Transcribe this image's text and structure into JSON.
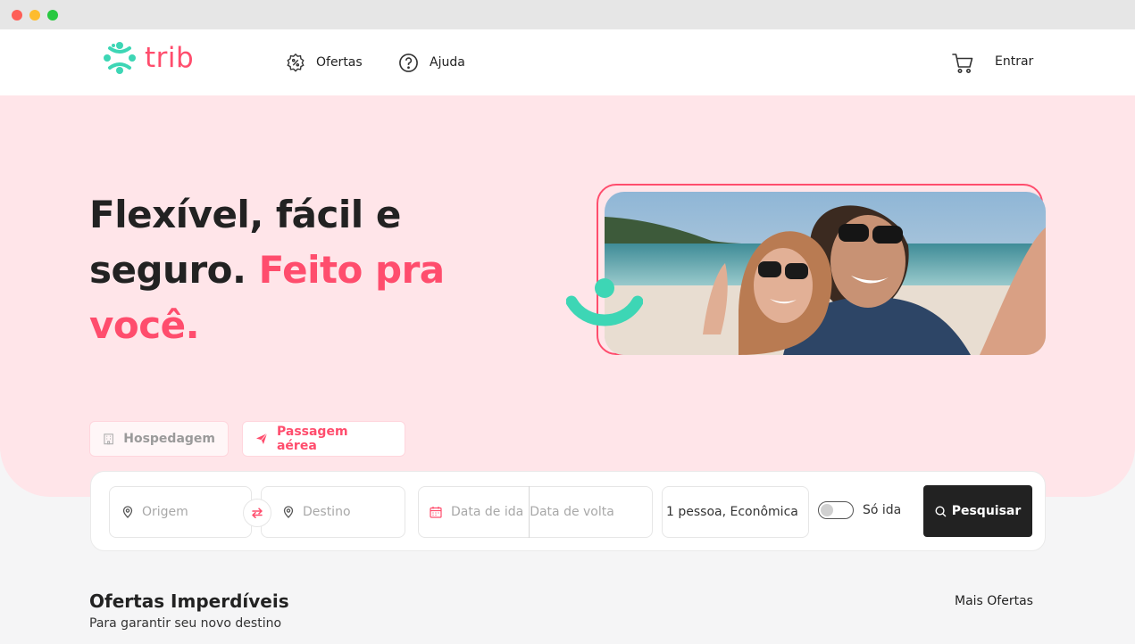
{
  "nav": {
    "logo_text": "trib",
    "offers_label": "Ofertas",
    "help_label": "Ajuda",
    "login_label": "Entrar"
  },
  "hero": {
    "headline_part1": "Flexível, fácil e seguro.",
    "headline_accent": "Feito pra você."
  },
  "tabs": {
    "hotel_label": "Hospedagem",
    "flight_label": "Passagem aérea"
  },
  "search": {
    "origin_placeholder": "Origem",
    "destination_placeholder": "Destino",
    "departure_placeholder": "Data de ida",
    "return_placeholder": "Data de volta",
    "passengers_value": "1 pessoa, Econômica",
    "one_way_label": "Só ida",
    "one_way_enabled": false,
    "search_label": "Pesquisar"
  },
  "offers": {
    "title": "Ofertas Imperdíveis",
    "subtitle": "Para garantir seu novo destino",
    "more_label": "Mais Ofertas"
  },
  "colors": {
    "brand_pink": "#ff4d6d",
    "brand_teal": "#3dd6b5",
    "hero_bg": "#ffe5e9",
    "button_dark": "#222222"
  },
  "icons": {
    "logo": "trib-logo-icon",
    "offers": "discount-badge-icon",
    "help": "question-circle-icon",
    "cart": "shopping-cart-icon",
    "hotel": "building-icon",
    "flight": "paper-plane-icon",
    "origin": "location-pin-icon",
    "destination": "location-pin-icon",
    "swap": "swap-arrows-icon",
    "date": "calendar-icon",
    "search": "search-icon"
  }
}
